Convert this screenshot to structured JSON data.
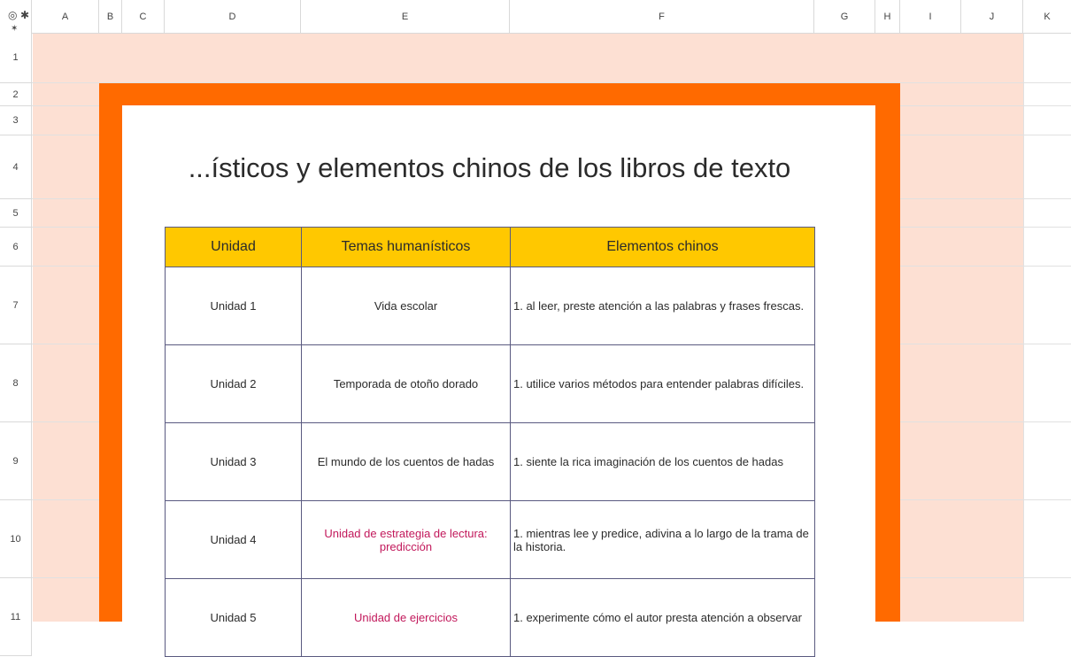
{
  "columns": [
    "A",
    "B",
    "C",
    "D",
    "E",
    "F",
    "G",
    "H",
    "I",
    "J",
    "K"
  ],
  "rows": [
    "1",
    "2",
    "3",
    "4",
    "5",
    "6",
    "7",
    "8",
    "9",
    "10",
    "11"
  ],
  "icons": {
    "view": "eye-icon",
    "freeze": "freeze-columns-icon",
    "freeze_rows": "freeze-rows-icon"
  },
  "colors": {
    "frame": "#ff6a00",
    "background_band": "#fde0d3",
    "header_fill": "#ffc800",
    "highlight_text": "#c2185b"
  },
  "title": "...ísticos y elementos chinos de los libros de texto",
  "table": {
    "headers": [
      "Unidad",
      "Temas humanísticos",
      "Elementos chinos"
    ],
    "rows": [
      {
        "unit": "Unidad 1",
        "theme": "Vida escolar",
        "element": "1. al leer, preste atención a las palabras y frases frescas."
      },
      {
        "unit": "Unidad 2",
        "theme": "Temporada de otoño dorado",
        "element": "1. utilice varios métodos para entender palabras difíciles."
      },
      {
        "unit": "Unidad 3",
        "theme": "El mundo de los cuentos de hadas",
        "element": "1. siente la rica imaginación de los cuentos de hadas"
      },
      {
        "unit": "Unidad 4",
        "theme": "Unidad de estrategia de lectura: predicción",
        "element": "1. mientras lee y predice, adivina a lo largo de la trama de la historia."
      },
      {
        "unit": "Unidad 5",
        "theme": "Unidad de ejercicios",
        "element": "1. experimente cómo el autor presta atención a observar"
      }
    ]
  }
}
